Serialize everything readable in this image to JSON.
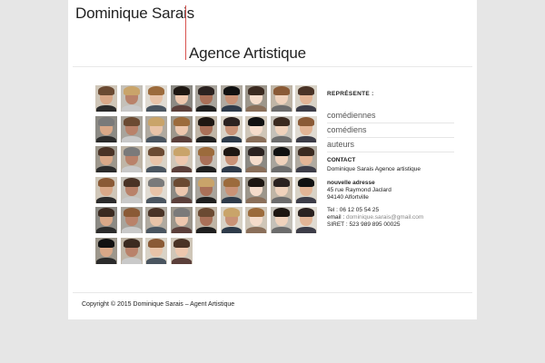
{
  "header": {
    "name": "Dominique Sarais",
    "subtitle": "Agence Artistique"
  },
  "colors": {
    "accent_rule": "#d9534f",
    "page_bg": "#ffffff",
    "outer_bg": "#e6e6e6"
  },
  "photo_grid": {
    "rows": [
      9,
      9,
      9,
      9,
      9,
      4
    ],
    "alt": "portrait-photo"
  },
  "sidebar": {
    "represente": "REPRÉSENTE :",
    "menu": [
      {
        "label": "comédiennes"
      },
      {
        "label": "comédiens"
      },
      {
        "label": "auteurs"
      }
    ],
    "contact": {
      "title": "CONTACT",
      "agency": "Dominique Sarais Agence artistique",
      "new_address_label": "nouvelle adresse",
      "street": "45 rue Raymond Jaclard",
      "city": "94140 Alfortville",
      "tel": "Tel : 06 12 05 54 25",
      "email_label": "email : ",
      "email": "dominique.sarais@gmail.com",
      "siret": "SIRET : 523 989 895 00025"
    }
  },
  "footer": {
    "copyright": "Copyright © 2015 Dominique Sarais – Agent Artistique"
  }
}
